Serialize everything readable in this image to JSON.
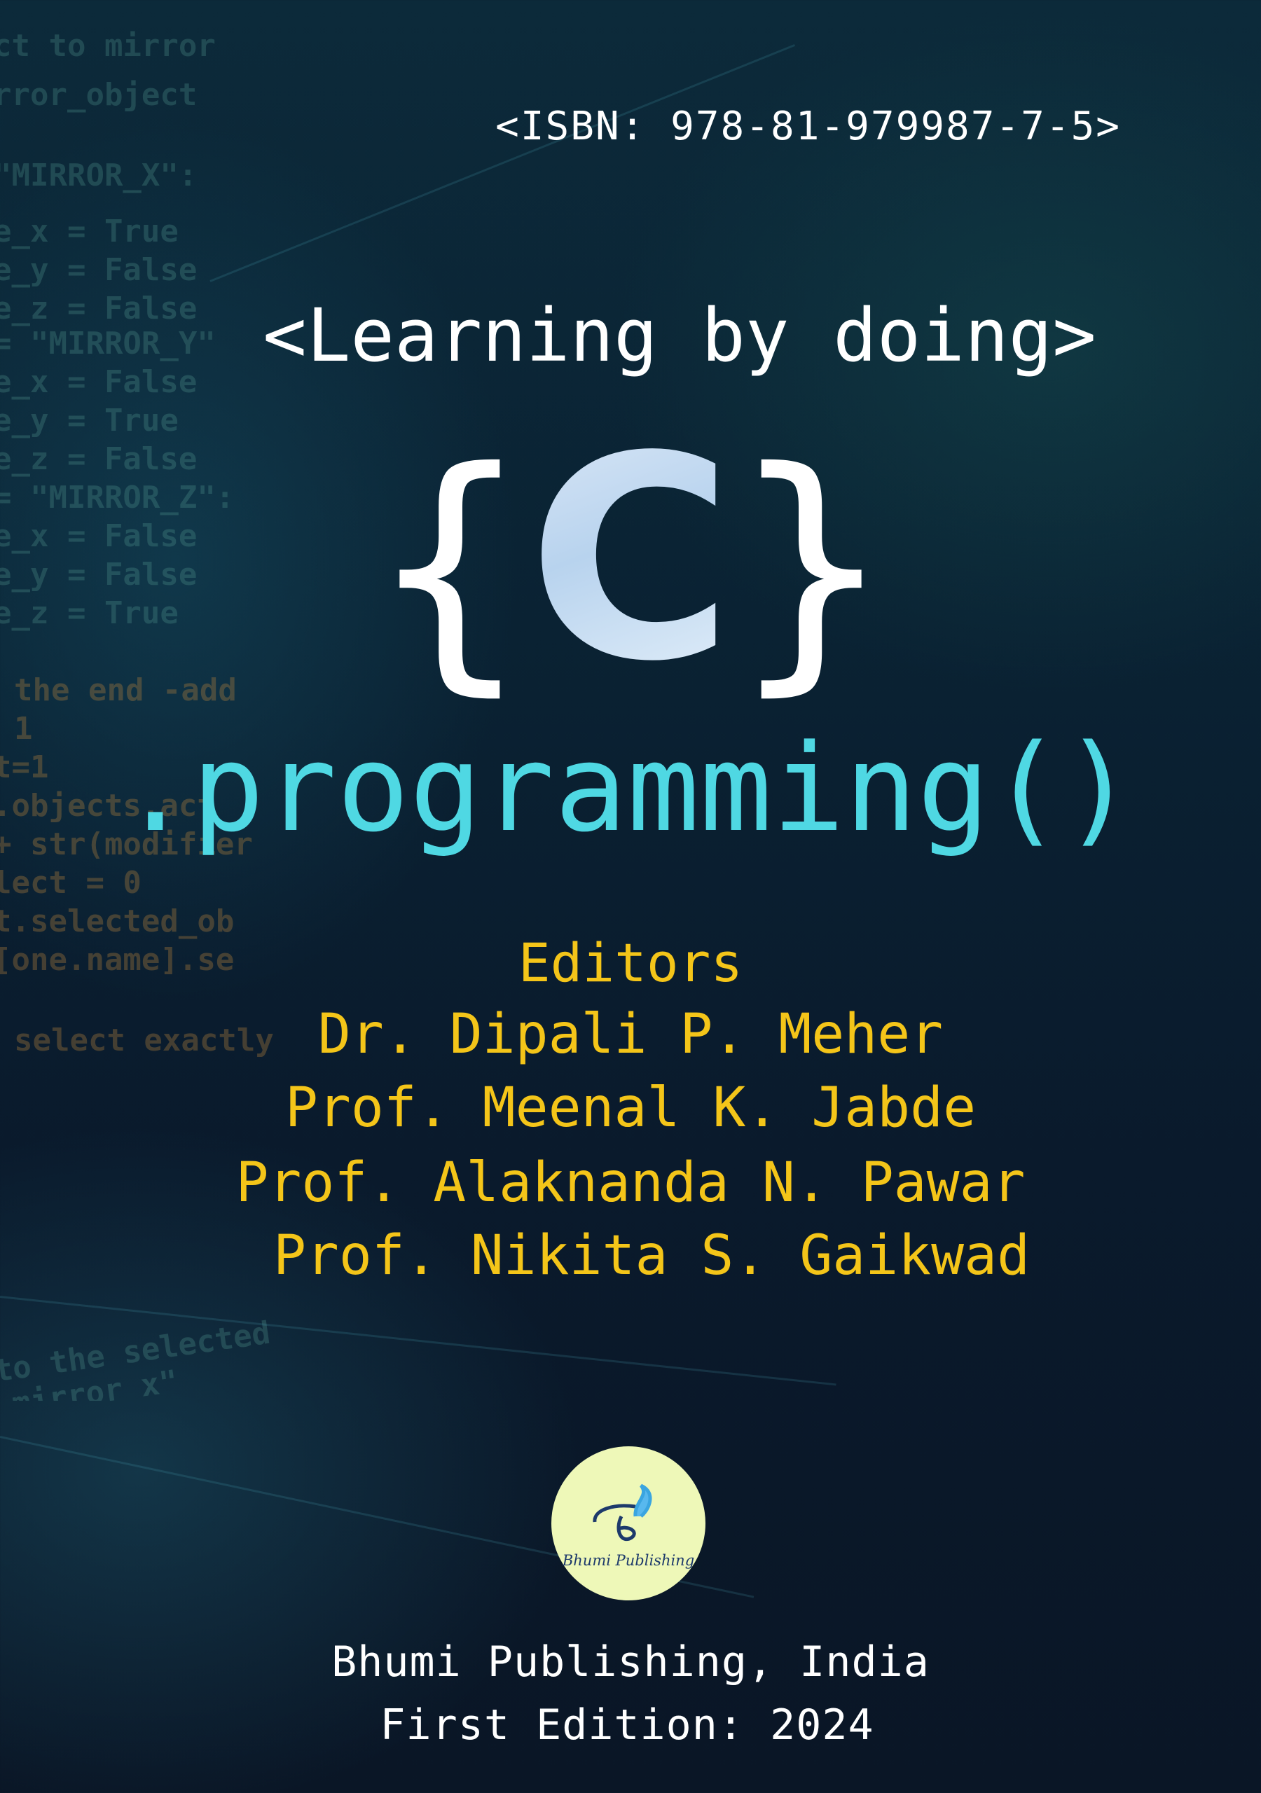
{
  "isbn": "<ISBN: 978-81-979987-7-5>",
  "tagline": "<Learning by doing>",
  "title": {
    "open_brace": "{",
    "letter": "C",
    "close_brace": "}",
    "subtitle": ".programming()"
  },
  "editors": {
    "heading": "Editors",
    "names": [
      "Dr. Dipali P. Meher",
      "Prof. Meenal K. Jabde",
      "Prof. Alaknanda N. Pawar",
      "Prof. Nikita S. Gaikwad"
    ]
  },
  "publisher_logo": {
    "text": "Bhumi Publishing"
  },
  "publisher": "Bhumi Publishing, India",
  "edition": "First Edition: 2024",
  "background_code": [
    "ct to mirror",
    "rror_object",
    "\"MIRROR_X\":",
    "e_x = True",
    "e_y = False",
    "e_z = False",
    "= \"MIRROR_Y\"",
    "e_x = False",
    "e_y = True",
    "e_z = False",
    "= \"MIRROR_Z\":",
    "e_x = False",
    "e_y = False",
    "e_z = True",
    "the end -add",
    "1",
    "t=1",
    ".objects.act",
    "+ str(modifier",
    "lect = 0",
    "t.selected_ob",
    "[one.name].se",
    "select exactly",
    "to the selected",
    "_mirror_x\""
  ],
  "colors": {
    "title_cyan": "#4fd8e3",
    "editors_gold": "#f4c519",
    "logo_bg": "#eef8b8",
    "background": "#0a1e2e"
  }
}
